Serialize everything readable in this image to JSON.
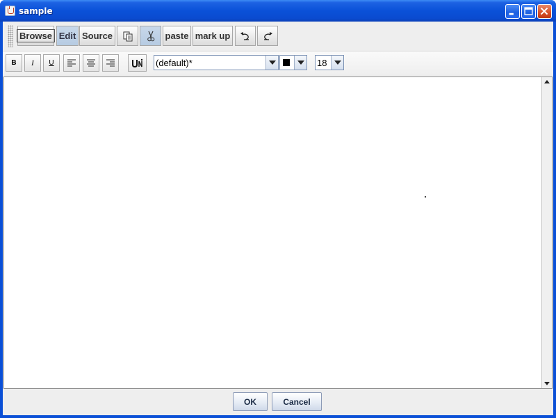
{
  "window": {
    "title": "sample",
    "controls": [
      "minimize-icon",
      "maximize-icon",
      "close-icon"
    ]
  },
  "toolbar": {
    "browse_label": "Browse",
    "edit_label": "Edit",
    "source_label": "Source",
    "copy_icon": "copy-icon",
    "cut_icon": "cut-icon",
    "paste_label": "paste",
    "markup_label": "mark up",
    "undo_icon": "undo-icon",
    "redo_icon": "redo-icon"
  },
  "format": {
    "bold_label": "B",
    "italic_label": "I",
    "underline_label": "U",
    "font_family_value": "(default)*",
    "color_value": "#000000",
    "font_size_value": "18"
  },
  "buttons": {
    "ok_label": "OK",
    "cancel_label": "Cancel"
  },
  "colors": {
    "title_bar": "#0a51d8",
    "selected_tab": "#b6cbe2"
  }
}
